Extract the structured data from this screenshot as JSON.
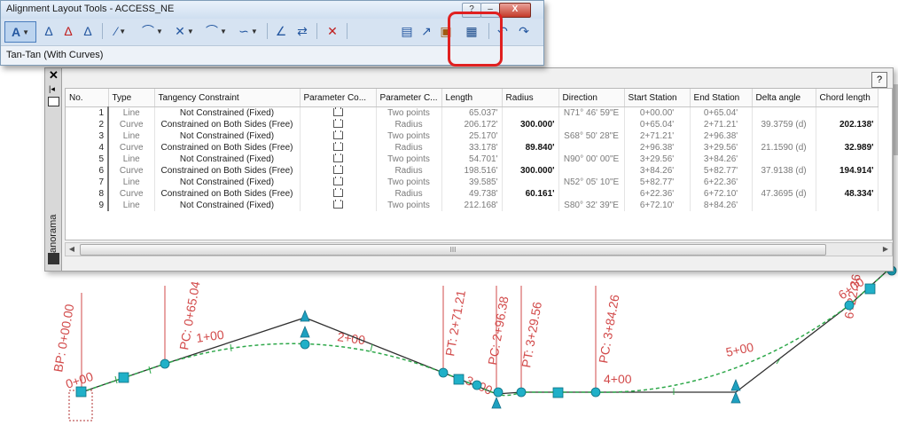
{
  "toolbar_window": {
    "title": "Alignment Layout Tools - ACCESS_NE",
    "help_glyph": "?",
    "close_glyph": "X",
    "status": "Tan-Tan (With Curves)",
    "tools": [
      {
        "icon": "tangent-tangent-icon",
        "glyph": "A",
        "dropdown": true
      },
      {
        "icon": "insert-pi-icon",
        "glyph": "Δ"
      },
      {
        "icon": "delete-pi-icon",
        "glyph": "Δ"
      },
      {
        "icon": "break-apart-pi-icon",
        "glyph": "Δ"
      },
      {
        "icon": "line-tool-icon",
        "glyph": "⁄",
        "dropdown": true
      },
      {
        "icon": "curve-tool-icon",
        "glyph": "⌒",
        "dropdown": true
      },
      {
        "icon": "spiral-curve-icon",
        "glyph": "✕",
        "dropdown": true
      },
      {
        "icon": "spiral-tool-icon",
        "glyph": "⌒",
        "dropdown": true
      },
      {
        "icon": "reverse-curve-icon",
        "glyph": "∽",
        "dropdown": true
      },
      {
        "icon": "convert-line-curve-icon",
        "glyph": "∠"
      },
      {
        "icon": "reverse-direction-icon",
        "glyph": "⇄"
      },
      {
        "icon": "delete-subentity-icon",
        "glyph": "✕"
      },
      {
        "icon": "edit-best-fit-icon",
        "glyph": "▤"
      },
      {
        "icon": "pick-subentity-icon",
        "glyph": "↗"
      },
      {
        "icon": "subentity-editor-icon",
        "glyph": "▣"
      },
      {
        "icon": "alignment-grid-view-icon",
        "glyph": "▦"
      },
      {
        "icon": "undo-icon",
        "glyph": "↶"
      },
      {
        "icon": "redo-icon",
        "glyph": "↷"
      }
    ]
  },
  "panorama": {
    "side_label": "Panorama",
    "help_glyph": "?",
    "close_glyph": "✕",
    "scroll_grip": "III",
    "columns": [
      "No.",
      "Type",
      "Tangency Constraint",
      "Parameter Co...",
      "Parameter C...",
      "Length",
      "Radius",
      "Direction",
      "Start Station",
      "End Station",
      "Delta angle",
      "Chord length"
    ],
    "rows": [
      {
        "no": "1",
        "type": "Line",
        "constraint": "Not Constrained (Fixed)",
        "param": "Two points",
        "length": "65.037'",
        "radius": "",
        "direction": "N71° 46' 59\"E",
        "start": "0+00.00'",
        "end": "0+65.04'",
        "delta": "",
        "chord": ""
      },
      {
        "no": "2",
        "type": "Curve",
        "constraint": "Constrained on Both Sides (Free)",
        "param": "Radius",
        "length": "206.172'",
        "radius": "300.000'",
        "direction": "",
        "start": "0+65.04'",
        "end": "2+71.21'",
        "delta": "39.3759 (d)",
        "chord": "202.138'"
      },
      {
        "no": "3",
        "type": "Line",
        "constraint": "Not Constrained (Fixed)",
        "param": "Two points",
        "length": "25.170'",
        "radius": "",
        "direction": "S68° 50' 28\"E",
        "start": "2+71.21'",
        "end": "2+96.38'",
        "delta": "",
        "chord": ""
      },
      {
        "no": "4",
        "type": "Curve",
        "constraint": "Constrained on Both Sides (Free)",
        "param": "Radius",
        "length": "33.178'",
        "radius": "89.840'",
        "direction": "",
        "start": "2+96.38'",
        "end": "3+29.56'",
        "delta": "21.1590 (d)",
        "chord": "32.989'"
      },
      {
        "no": "5",
        "type": "Line",
        "constraint": "Not Constrained (Fixed)",
        "param": "Two points",
        "length": "54.701'",
        "radius": "",
        "direction": "N90° 00' 00\"E",
        "start": "3+29.56'",
        "end": "3+84.26'",
        "delta": "",
        "chord": ""
      },
      {
        "no": "6",
        "type": "Curve",
        "constraint": "Constrained on Both Sides (Free)",
        "param": "Radius",
        "length": "198.516'",
        "radius": "300.000'",
        "direction": "",
        "start": "3+84.26'",
        "end": "5+82.77'",
        "delta": "37.9138 (d)",
        "chord": "194.914'"
      },
      {
        "no": "7",
        "type": "Line",
        "constraint": "Not Constrained (Fixed)",
        "param": "Two points",
        "length": "39.585'",
        "radius": "",
        "direction": "N52° 05' 10\"E",
        "start": "5+82.77'",
        "end": "6+22.36'",
        "delta": "",
        "chord": ""
      },
      {
        "no": "8",
        "type": "Curve",
        "constraint": "Constrained on Both Sides (Free)",
        "param": "Radius",
        "length": "49.738'",
        "radius": "60.161'",
        "direction": "",
        "start": "6+22.36'",
        "end": "6+72.10'",
        "delta": "47.3695 (d)",
        "chord": "48.334'"
      },
      {
        "no": "9",
        "type": "Line",
        "constraint": "Not Constrained (Fixed)",
        "param": "Two points",
        "length": "212.168'",
        "radius": "",
        "direction": "S80° 32' 39\"E",
        "start": "6+72.10'",
        "end": "8+84.26'",
        "delta": "",
        "chord": ""
      }
    ]
  },
  "drawing": {
    "labels": {
      "bp": "BP: 0+00.00",
      "pc1": "PC: 0+65.04",
      "pt1": "PT: 2+71.21",
      "pc2": "PC: 2+96.38",
      "pt2": "PT: 3+29.56",
      "pc3": "PC: 3+84.26",
      "pc4": "6+22.36",
      "sta0": "0+00",
      "sta1": "1+00",
      "sta2": "2+00",
      "sta3": "3+00",
      "sta4": "4+00",
      "sta5": "5+00",
      "sta6": "6+00"
    },
    "colors": {
      "tangent": "#303030",
      "curve": "#2ea84a",
      "grip": "#20b0c8",
      "label": "#d24a4a",
      "pi": "#1ea0c0"
    }
  }
}
